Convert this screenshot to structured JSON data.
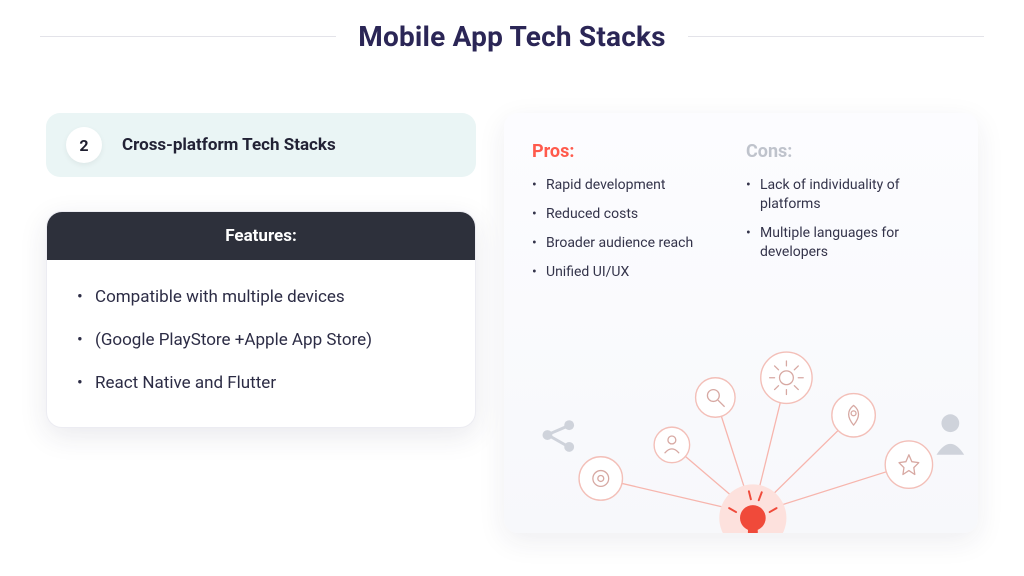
{
  "title": "Mobile App Tech Stacks",
  "section": {
    "number": "2",
    "label": "Cross-platform Tech Stacks"
  },
  "features": {
    "heading": "Features:",
    "items": [
      "Compatible with multiple devices",
      "(Google PlayStore +Apple App Store)",
      "React Native and Flutter"
    ]
  },
  "pros": {
    "heading": "Pros:",
    "items": [
      "Rapid development",
      "Reduced costs",
      "Broader audience reach",
      "Unified UI/UX"
    ]
  },
  "cons": {
    "heading": "Cons:",
    "items": [
      "Lack of individuality of platforms",
      "Multiple languages for developers"
    ]
  },
  "colors": {
    "heading": "#2b2656",
    "pillBg": "#eaf5f5",
    "cardHead": "#2d303b",
    "pros": "#ff5a4c",
    "consMuted": "#bfc3cc",
    "illusAccent": "#f76255",
    "illusSoft": "#fde1dd",
    "illusGrey": "#cfd3db"
  }
}
